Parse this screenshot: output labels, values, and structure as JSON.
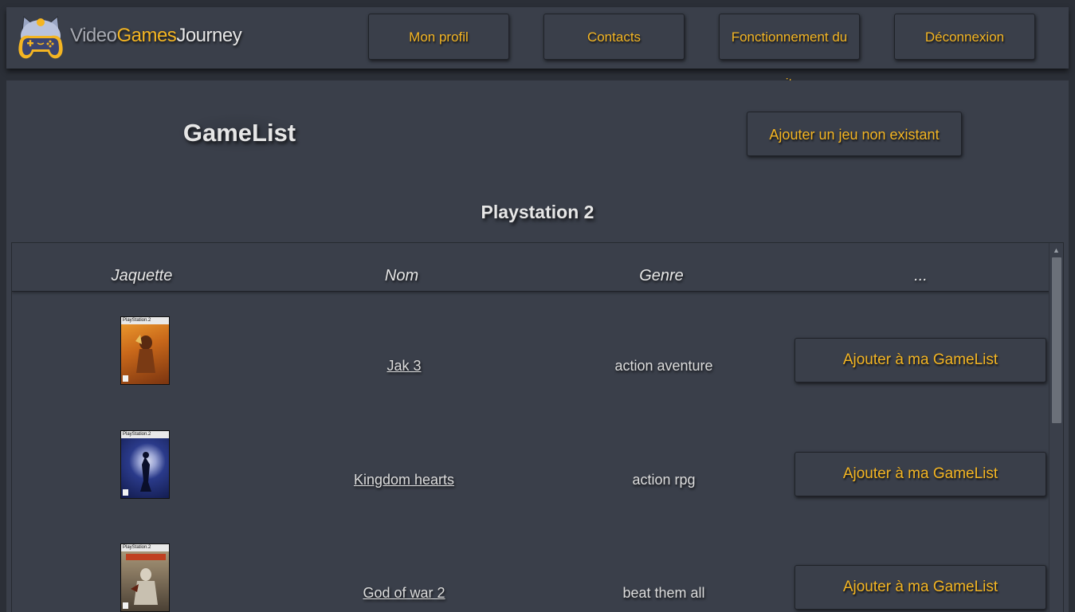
{
  "header": {
    "brand": {
      "part1": "Video",
      "part2": "Games",
      "part3": "Journey"
    },
    "nav": [
      {
        "label": "Mon profil"
      },
      {
        "label": "Contacts"
      },
      {
        "label": "Fonctionnement du site"
      },
      {
        "label": "Déconnexion"
      }
    ],
    "colors": {
      "accent": "#f4b522",
      "bar": "#3a3f4a",
      "page": "#2b2f37"
    }
  },
  "main": {
    "title": "GameList",
    "add_button": "Ajouter un jeu non existant",
    "platform": "Playstation 2"
  },
  "table": {
    "columns": [
      "Jaquette",
      "Nom",
      "Genre",
      "..."
    ],
    "rows": [
      {
        "cover_label": "PlayStation.2",
        "name": "Jak 3",
        "genre": "action aventure",
        "action": "Ajouter à ma GameList",
        "cover_color": "#d67a1c"
      },
      {
        "cover_label": "PlayStation.2",
        "name": "Kingdom hearts",
        "genre": "action rpg",
        "action": "Ajouter à ma GameList",
        "cover_color": "#1b2a6a"
      },
      {
        "cover_label": "PlayStation.2",
        "name": "God of war 2",
        "genre": "beat them all",
        "action": "Ajouter à ma GameList",
        "cover_color": "#8a7a62"
      }
    ]
  }
}
